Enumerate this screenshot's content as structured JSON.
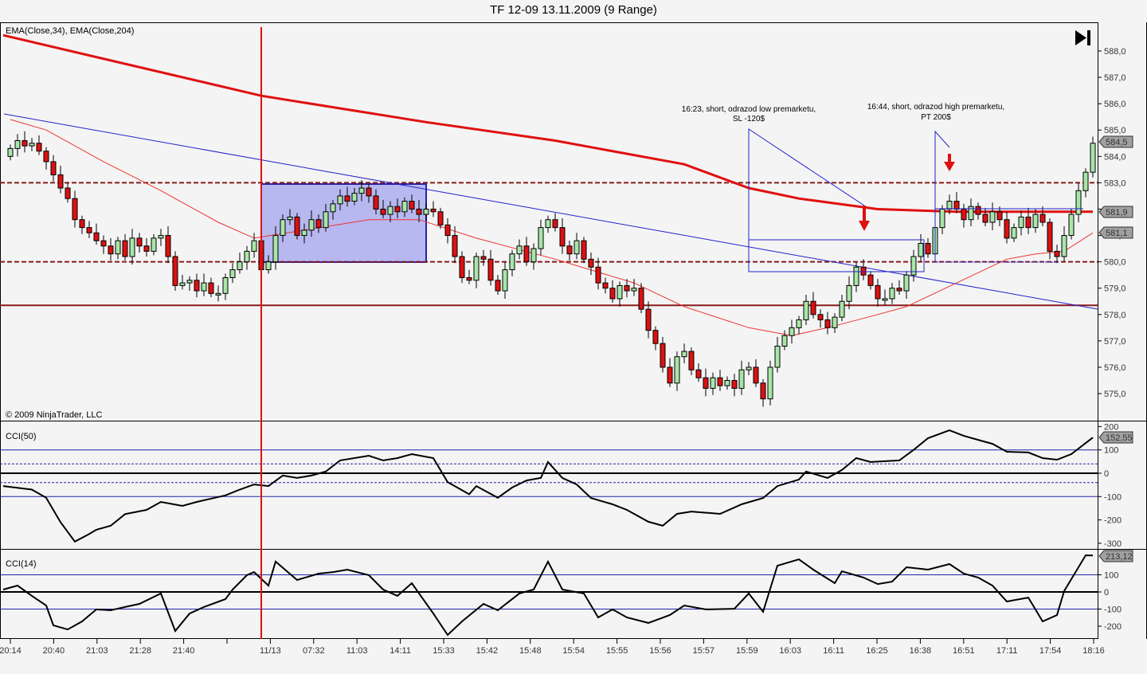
{
  "title": "TF 12-09  13.11.2009 (9 Range)",
  "copyright": "© 2009 NinjaTrader, LLC",
  "colors": {
    "up": "#a8e6a8",
    "down": "#dd1111",
    "ema204": "#e01010",
    "ema34": "#ee3333",
    "trend": "#2222cc",
    "level": "#8b1a1a",
    "box": "#b8b8f0"
  },
  "annotations": [
    {
      "line1": "16:23, short, odrazod low premarketu,",
      "line2": "SL -120$"
    },
    {
      "line1": "16:44, short, odrazod high premarketu,",
      "line2": "PT 200$"
    }
  ],
  "chart_data": [
    {
      "type": "candlestick",
      "title": "EMA(Close,34), EMA(Close,204)",
      "ylim": [
        574.3,
        589.1
      ],
      "yticks": [
        "588,0",
        "587,0",
        "586,0",
        "585,0",
        "584,0",
        "583,0",
        "582,0",
        "581,0",
        "580,0",
        "579,0",
        "578,0",
        "577,0",
        "576,0",
        "575,0"
      ],
      "ytick_values": [
        588,
        587,
        586,
        585,
        584,
        583,
        582,
        581,
        580,
        579,
        578,
        577,
        576,
        575
      ],
      "first_open": 584.0,
      "closes": [
        584.3,
        584.6,
        584.4,
        584.5,
        584.2,
        583.8,
        583.3,
        582.8,
        582.4,
        581.6,
        581.3,
        581.1,
        580.8,
        580.6,
        580.3,
        580.8,
        580.2,
        580.9,
        580.6,
        580.4,
        580.9,
        581.0,
        580.2,
        579.1,
        579.2,
        579.3,
        578.9,
        579.2,
        578.8,
        578.8,
        579.4,
        579.7,
        580.0,
        580.4,
        580.8,
        579.7,
        580.0,
        581.0,
        581.6,
        581.7,
        581.0,
        581.2,
        581.6,
        581.3,
        581.9,
        582.2,
        582.5,
        582.3,
        582.6,
        582.8,
        582.5,
        582.0,
        581.8,
        582.1,
        581.9,
        582.3,
        582.0,
        581.8,
        582.0,
        581.9,
        581.4,
        581.0,
        580.2,
        579.4,
        579.3,
        580.2,
        580.1,
        579.3,
        578.9,
        579.7,
        580.3,
        580.6,
        580.0,
        580.5,
        581.3,
        581.6,
        581.3,
        580.6,
        580.3,
        580.8,
        580.1,
        579.8,
        579.2,
        579.0,
        578.6,
        579.1,
        578.9,
        579.0,
        578.2,
        577.4,
        576.9,
        576.0,
        575.4,
        576.4,
        576.6,
        575.9,
        575.6,
        575.2,
        575.6,
        575.3,
        575.5,
        575.2,
        575.9,
        576.0,
        575.4,
        574.8,
        576.0,
        576.8,
        577.2,
        577.5,
        577.8,
        578.5,
        578.0,
        577.8,
        577.5,
        577.9,
        578.5,
        579.1,
        579.8,
        579.5,
        579.1,
        578.6,
        578.6,
        579.0,
        578.9,
        579.5,
        580.2,
        580.7,
        580.3,
        581.3,
        582.0,
        582.3,
        582.0,
        581.6,
        582.1,
        581.8,
        581.5,
        581.9,
        581.6,
        580.9,
        581.3,
        581.7,
        581.3,
        581.8,
        581.5,
        580.4,
        580.2,
        581.0,
        581.8,
        582.7,
        583.4,
        584.5
      ],
      "ema204": [
        [
          -1,
          588.6
        ],
        [
          35,
          586.3
        ],
        [
          58,
          585.3
        ],
        [
          76,
          584.6
        ],
        [
          94,
          583.7
        ],
        [
          103,
          582.8
        ],
        [
          110,
          582.4
        ],
        [
          121,
          582.0
        ],
        [
          132,
          581.9
        ],
        [
          151,
          581.9
        ]
      ],
      "ema34": [
        [
          0,
          585.4
        ],
        [
          5,
          585.0
        ],
        [
          13,
          583.8
        ],
        [
          21,
          582.7
        ],
        [
          29,
          581.5
        ],
        [
          34,
          580.9
        ],
        [
          41,
          581.2
        ],
        [
          50,
          581.6
        ],
        [
          57,
          581.6
        ],
        [
          65,
          580.9
        ],
        [
          76,
          580.1
        ],
        [
          87,
          579.2
        ],
        [
          94,
          578.3
        ],
        [
          103,
          577.5
        ],
        [
          109,
          577.2
        ],
        [
          114,
          577.5
        ],
        [
          121,
          578.0
        ],
        [
          125,
          578.3
        ],
        [
          132,
          579.2
        ],
        [
          139,
          580.1
        ],
        [
          143,
          580.3
        ],
        [
          147,
          580.4
        ],
        [
          151,
          581.1
        ]
      ],
      "levels": [
        583.0,
        580.0,
        578.35
      ],
      "last_labels": {
        "price": "584,5",
        "ema204": "581,9",
        "ema34": "581,1"
      }
    },
    {
      "type": "line",
      "title": "CCI(50)",
      "ylim": [
        -310,
        210
      ],
      "yticks": [
        "200",
        "100",
        "0",
        "-100",
        "-200",
        "-300"
      ],
      "ytick_values": [
        200,
        100,
        0,
        -100,
        -200,
        -300
      ],
      "points": [
        [
          -1,
          -55
        ],
        [
          3,
          -70
        ],
        [
          5,
          -105
        ],
        [
          7,
          -210
        ],
        [
          9,
          -293
        ],
        [
          11,
          -260
        ],
        [
          12,
          -242
        ],
        [
          14,
          -225
        ],
        [
          16,
          -175
        ],
        [
          19,
          -157
        ],
        [
          21,
          -123
        ],
        [
          24,
          -140
        ],
        [
          26,
          -123
        ],
        [
          30,
          -95
        ],
        [
          32,
          -70
        ],
        [
          34,
          -48
        ],
        [
          36,
          -55
        ],
        [
          38,
          -10
        ],
        [
          40,
          -20
        ],
        [
          42,
          -10
        ],
        [
          44,
          7
        ],
        [
          46,
          55
        ],
        [
          50,
          75
        ],
        [
          52,
          55
        ],
        [
          54,
          65
        ],
        [
          56,
          82
        ],
        [
          59,
          65
        ],
        [
          61,
          -38
        ],
        [
          64,
          -90
        ],
        [
          65,
          -55
        ],
        [
          68,
          -105
        ],
        [
          70,
          -61
        ],
        [
          72,
          -31
        ],
        [
          74,
          -20
        ],
        [
          75,
          48
        ],
        [
          77,
          -20
        ],
        [
          79,
          -48
        ],
        [
          81,
          -106
        ],
        [
          84,
          -133
        ],
        [
          86,
          -157
        ],
        [
          89,
          -208
        ],
        [
          91,
          -225
        ],
        [
          93,
          -174
        ],
        [
          95,
          -164
        ],
        [
          99,
          -174
        ],
        [
          102,
          -133
        ],
        [
          105,
          -106
        ],
        [
          107,
          -55
        ],
        [
          110,
          -27
        ],
        [
          111,
          7
        ],
        [
          114,
          -20
        ],
        [
          116,
          14
        ],
        [
          118,
          65
        ],
        [
          120,
          48
        ],
        [
          124,
          55
        ],
        [
          126,
          100
        ],
        [
          128,
          150
        ],
        [
          131,
          184
        ],
        [
          133,
          160
        ],
        [
          135,
          143
        ],
        [
          137,
          126
        ],
        [
          139,
          92
        ],
        [
          142,
          89
        ],
        [
          144,
          65
        ],
        [
          146,
          58
        ],
        [
          148,
          82
        ],
        [
          151,
          153
        ]
      ],
      "last_label": "152,55"
    },
    {
      "type": "line",
      "title": "CCI(14)",
      "ylim": [
        -270,
        260
      ],
      "yticks": [
        "100",
        "0",
        "-100",
        "-200"
      ],
      "ytick_values": [
        100,
        0,
        -100,
        -200
      ],
      "points": [
        [
          -1,
          14
        ],
        [
          1,
          37
        ],
        [
          3,
          -23
        ],
        [
          5,
          -79
        ],
        [
          6,
          -195
        ],
        [
          8,
          -219
        ],
        [
          10,
          -172
        ],
        [
          12,
          -102
        ],
        [
          14,
          -107
        ],
        [
          16,
          -88
        ],
        [
          18,
          -70
        ],
        [
          21,
          -9
        ],
        [
          23,
          -228
        ],
        [
          25,
          -126
        ],
        [
          27,
          -88
        ],
        [
          30,
          -42
        ],
        [
          31,
          14
        ],
        [
          33,
          98
        ],
        [
          34,
          116
        ],
        [
          36,
          37
        ],
        [
          37,
          177
        ],
        [
          40,
          70
        ],
        [
          43,
          107
        ],
        [
          45,
          116
        ],
        [
          47,
          130
        ],
        [
          50,
          98
        ],
        [
          52,
          14
        ],
        [
          54,
          -23
        ],
        [
          56,
          51
        ],
        [
          59,
          -126
        ],
        [
          61,
          -251
        ],
        [
          63,
          -172
        ],
        [
          66,
          -70
        ],
        [
          68,
          -107
        ],
        [
          71,
          -9
        ],
        [
          73,
          14
        ],
        [
          75,
          177
        ],
        [
          77,
          14
        ],
        [
          80,
          -9
        ],
        [
          82,
          -149
        ],
        [
          84,
          -102
        ],
        [
          86,
          -149
        ],
        [
          89,
          -181
        ],
        [
          92,
          -135
        ],
        [
          94,
          -79
        ],
        [
          97,
          -102
        ],
        [
          101,
          -98
        ],
        [
          103,
          -9
        ],
        [
          105,
          -116
        ],
        [
          107,
          153
        ],
        [
          110,
          190
        ],
        [
          112,
          130
        ],
        [
          115,
          51
        ],
        [
          116,
          121
        ],
        [
          119,
          84
        ],
        [
          121,
          46
        ],
        [
          123,
          60
        ],
        [
          125,
          144
        ],
        [
          128,
          130
        ],
        [
          131,
          163
        ],
        [
          133,
          107
        ],
        [
          135,
          84
        ],
        [
          137,
          37
        ],
        [
          139,
          -56
        ],
        [
          142,
          -33
        ],
        [
          144,
          -172
        ],
        [
          146,
          -135
        ],
        [
          147,
          5
        ],
        [
          150,
          214
        ],
        [
          151,
          213
        ]
      ],
      "last_label": "213,12"
    }
  ],
  "xaxis": {
    "labels": [
      "20:14",
      "20:40",
      "21:03",
      "21:28",
      "21:40",
      "",
      "11/13",
      "07:32",
      "11:03",
      "14:11",
      "15:33",
      "15:42",
      "15:48",
      "15:54",
      "15:55",
      "15:56",
      "15:57",
      "15:59",
      "16:03",
      "16:11",
      "16:25",
      "16:38",
      "16:51",
      "17:11",
      "17:54",
      "18:16"
    ]
  }
}
